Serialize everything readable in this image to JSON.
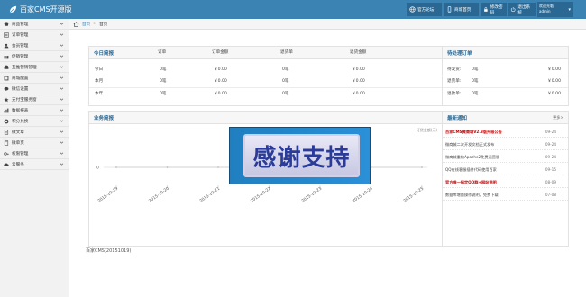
{
  "app": {
    "title": "百家CMS开源版"
  },
  "colors": {
    "topbar": "#3a83b3",
    "accent": "#2a6893",
    "hot": "#d00000",
    "overlay": "#1f7fc0"
  },
  "header": {
    "buttons": [
      {
        "label": "官方论坛",
        "icon": "globe-icon"
      },
      {
        "label": "商城首页",
        "icon": "mobile-icon"
      },
      {
        "label": "修改密码",
        "icon": "lock-icon"
      },
      {
        "label": "退出系统",
        "icon": "power-icon"
      }
    ],
    "user": {
      "greeting": "欢迎光临,",
      "name": "admin"
    }
  },
  "sidebar": {
    "items": [
      {
        "label": "商品管理",
        "icon": "shop-icon"
      },
      {
        "label": "订单管理",
        "icon": "list-icon"
      },
      {
        "label": "会员管理",
        "icon": "user-icon"
      },
      {
        "label": "促销管理",
        "icon": "gift-icon"
      },
      {
        "label": "互推营销管理",
        "icon": "share-icon"
      },
      {
        "label": "商城配置",
        "icon": "settings-icon"
      },
      {
        "label": "微信设置",
        "icon": "chat-icon"
      },
      {
        "label": "支付宝服务窗",
        "icon": "star-icon"
      },
      {
        "label": "数据报表",
        "icon": "chart-icon"
      },
      {
        "label": "积分兑换",
        "icon": "coin-icon"
      },
      {
        "label": "微文章",
        "icon": "doc-icon"
      },
      {
        "label": "微单页",
        "icon": "page-icon"
      },
      {
        "label": "权限管理",
        "icon": "key-icon"
      },
      {
        "label": "云服务",
        "icon": "cloud-icon"
      }
    ]
  },
  "breadcrumb": {
    "home": "首页",
    "current": "首页"
  },
  "daily": {
    "title": "今日简报",
    "headers": [
      "订单",
      "订单金额",
      "退货单",
      "退货金额"
    ],
    "rows": [
      {
        "label": "今日",
        "orders": "0笔",
        "amount": "￥0.00",
        "returns": "0笔",
        "return_amount": "￥0.00"
      },
      {
        "label": "本月",
        "orders": "0笔",
        "amount": "￥0.00",
        "returns": "0笔",
        "return_amount": "￥0.00"
      },
      {
        "label": "本年",
        "orders": "0笔",
        "amount": "￥0.00",
        "returns": "0笔",
        "return_amount": "￥0.00"
      }
    ]
  },
  "pending": {
    "title": "待处理订单",
    "rows": [
      {
        "label": "待发货:",
        "count": "0笔",
        "amount": "￥0.00"
      },
      {
        "label": "退货单:",
        "count": "0笔",
        "amount": "￥0.00"
      },
      {
        "label": "退款单:",
        "count": "0笔",
        "amount": "￥0.00"
      }
    ]
  },
  "business": {
    "title": "业务简报",
    "legend": "订货金额(元)"
  },
  "chart_data": {
    "type": "line",
    "x": [
      "2015-10-19",
      "2015-10-20",
      "2015-10-21",
      "2015-10-22",
      "2015-10-23",
      "2015-10-24",
      "2015-10-25"
    ],
    "series": [
      {
        "name": "订货金额(元)",
        "values": [
          0,
          0,
          0,
          0,
          0,
          0,
          0
        ]
      }
    ],
    "ytick": "0",
    "ylim": [
      0,
      1
    ]
  },
  "notices": {
    "title": "最新通知",
    "more": "更多>",
    "items": [
      {
        "text": "百家CMS微商城V2.3版升级公告",
        "date": "09-24",
        "hot": true
      },
      {
        "text": "微商城二次开发文档正式发布",
        "date": "09-24",
        "hot": false
      },
      {
        "text": "微商城重构Apache2免费运营版",
        "date": "09-24",
        "hot": false
      },
      {
        "text": "QQ在线客服插件代码使用百家",
        "date": "09-15",
        "hot": false
      },
      {
        "text": "官方唯一指定QQ群+网站说明",
        "date": "08-09",
        "hot": true
      },
      {
        "text": "数据库增量操作说明，免费下载",
        "date": "07-08",
        "hot": false
      }
    ]
  },
  "overlay": {
    "text": "感谢支持"
  },
  "footer": {
    "text": "百家CMS(20151019)"
  }
}
